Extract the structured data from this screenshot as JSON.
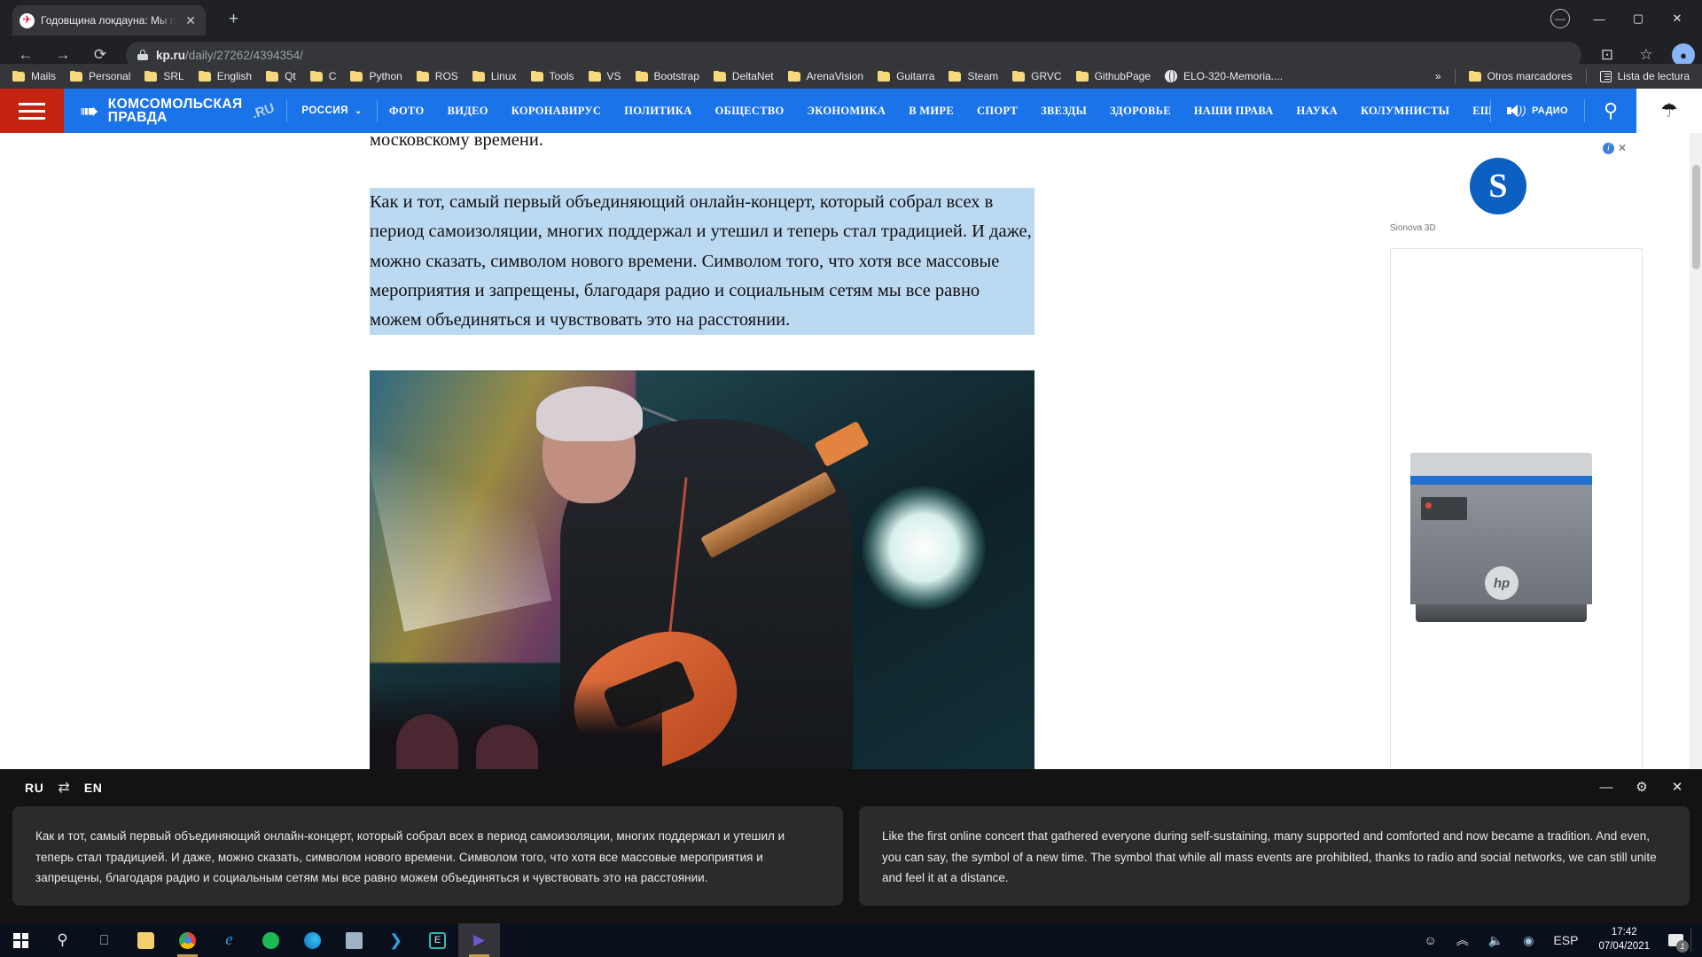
{
  "browser": {
    "tab": {
      "title": "Годовщина локдауна: Мы прор",
      "favicon": "kp-star-icon",
      "close": "✕"
    },
    "new_tab": "+",
    "window_controls": {
      "restore_circle": "⊙",
      "minimize": "—",
      "maximize": "▢",
      "close": "✕"
    },
    "nav": {
      "back": "←",
      "forward": "→",
      "reload": "⟳"
    },
    "omnibox": {
      "domain": "kp.ru",
      "path": "/daily/27262/4394354/",
      "lock": "lock-icon"
    },
    "toolbar_right": {
      "cast": "⊡",
      "star": "☆",
      "profile": "●"
    },
    "bookmarks": [
      {
        "label": "Mails",
        "icon": "folder-icon"
      },
      {
        "label": "Personal",
        "icon": "folder-icon"
      },
      {
        "label": "SRL",
        "icon": "folder-icon"
      },
      {
        "label": "English",
        "icon": "folder-icon"
      },
      {
        "label": "Qt",
        "icon": "folder-icon"
      },
      {
        "label": "C",
        "icon": "folder-icon"
      },
      {
        "label": "Python",
        "icon": "folder-icon"
      },
      {
        "label": "ROS",
        "icon": "folder-icon"
      },
      {
        "label": "Linux",
        "icon": "folder-icon"
      },
      {
        "label": "Tools",
        "icon": "folder-icon"
      },
      {
        "label": "VS",
        "icon": "folder-icon"
      },
      {
        "label": "Bootstrap",
        "icon": "folder-icon"
      },
      {
        "label": "DeltaNet",
        "icon": "folder-icon"
      },
      {
        "label": "ArenaVision",
        "icon": "folder-icon"
      },
      {
        "label": "Guitarra",
        "icon": "folder-icon"
      },
      {
        "label": "Steam",
        "icon": "folder-icon"
      },
      {
        "label": "GRVC",
        "icon": "folder-icon"
      },
      {
        "label": "GithubPage",
        "icon": "folder-icon"
      },
      {
        "label": "ELO-320-Memoria....",
        "icon": "globe-icon"
      }
    ],
    "bookmarks_overflow": "»",
    "other_bookmarks": "Otros marcadores",
    "reading_list": "Lista de lectura"
  },
  "site": {
    "menu_icon": "hamburger-icon",
    "brand": {
      "line1": "КОМСОМОЛЬСКАЯ",
      "line2": "ПРАВДА",
      "ru": ".RU"
    },
    "region": {
      "label": "РОССИЯ",
      "caret": "⌄"
    },
    "nav_links": [
      "ФОТО",
      "ВИДЕО",
      "КОРОНАВИРУС",
      "ПОЛИТИКА",
      "ОБЩЕСТВО",
      "ЭКОНОМИКА",
      "В МИРЕ",
      "СПОРТ",
      "ЗВЕЗДЫ",
      "ЗДОРОВЬЕ",
      "НАШИ ПРАВА",
      "НАУКА",
      "КОЛУМНИСТЫ"
    ],
    "more": {
      "label": "ЕЩЕ",
      "caret": "⌄"
    },
    "radio": {
      "label": "РАДИО",
      "icon": "speaker-icon"
    },
    "search_icon": "search-icon",
    "account_icon": "user-icon"
  },
  "article": {
    "paragraph_partial": "московскому времени.",
    "paragraph_selected": "Как и тот, самый первый объединяющий онлайн-концерт, который собрал всех в период самоизоляции, многих поддержал и утешил и теперь стал традицией. И даже, можно сказать, символом нового времени. Символом того, что хотя все массовые мероприятия и запрещены, благодаря радио и социальным сетям мы все равно можем объединяться и чувствовать это на расстоянии.",
    "image_alt": "guitarist-performing-photo"
  },
  "ad": {
    "info_icon": "ad-info-icon",
    "close_icon": "ad-close-icon",
    "logo_letter": "S",
    "caption": "Sionova 3D",
    "printer_brand": "hp"
  },
  "translator": {
    "source_lang": "RU",
    "swap_icon": "⇄",
    "target_lang": "EN",
    "minimize": "—",
    "settings": "⚙",
    "close": "✕",
    "source_text": "Как и тот, самый первый объединяющий онлайн-концерт, который собрал всех в период самоизоляции, многих поддержал и утешил и теперь стал традицией. И даже, можно сказать, символом нового времени. Символом того, что хотя все массовые мероприятия и запрещены, благодаря радио и социальным сетям мы все равно можем объединяться и чувствовать это на расстоянии.",
    "target_text": "Like the first online concert that gathered everyone during self-sustaining, many supported and comforted and now became a tradition. And even, you can say, the symbol of a new time. The symbol that while all mass events are prohibited, thanks to radio and social networks, we can still unite and feel it at a distance."
  },
  "taskbar": {
    "start": "windows-logo-icon",
    "items": [
      {
        "name": "search-icon",
        "glyph": "⌕"
      },
      {
        "name": "task-view-icon",
        "glyph": "❑"
      },
      {
        "name": "file-explorer-icon",
        "glyph": ""
      },
      {
        "name": "chrome-icon",
        "glyph": ""
      },
      {
        "name": "internet-explorer-icon",
        "glyph": "e"
      },
      {
        "name": "spotify-icon",
        "glyph": ""
      },
      {
        "name": "edge-icon",
        "glyph": ""
      },
      {
        "name": "calculator-icon",
        "glyph": ""
      },
      {
        "name": "vscode-icon",
        "glyph": ""
      },
      {
        "name": "evernote-icon",
        "glyph": "E"
      },
      {
        "name": "media-player-icon",
        "glyph": "▶"
      }
    ],
    "tray": {
      "people": "people-icon",
      "chevron": "︿",
      "volume": "volume-icon",
      "steam": "steam-icon",
      "language": "ESP",
      "time": "17:42",
      "date": "07/04/2021",
      "notifications_count": "1"
    }
  },
  "colors": {
    "brand_blue": "#1a73e8",
    "brand_red": "#c4240f",
    "selection": "#bcd9f2",
    "chrome_bg": "#202124",
    "translator_bg": "#131313"
  }
}
